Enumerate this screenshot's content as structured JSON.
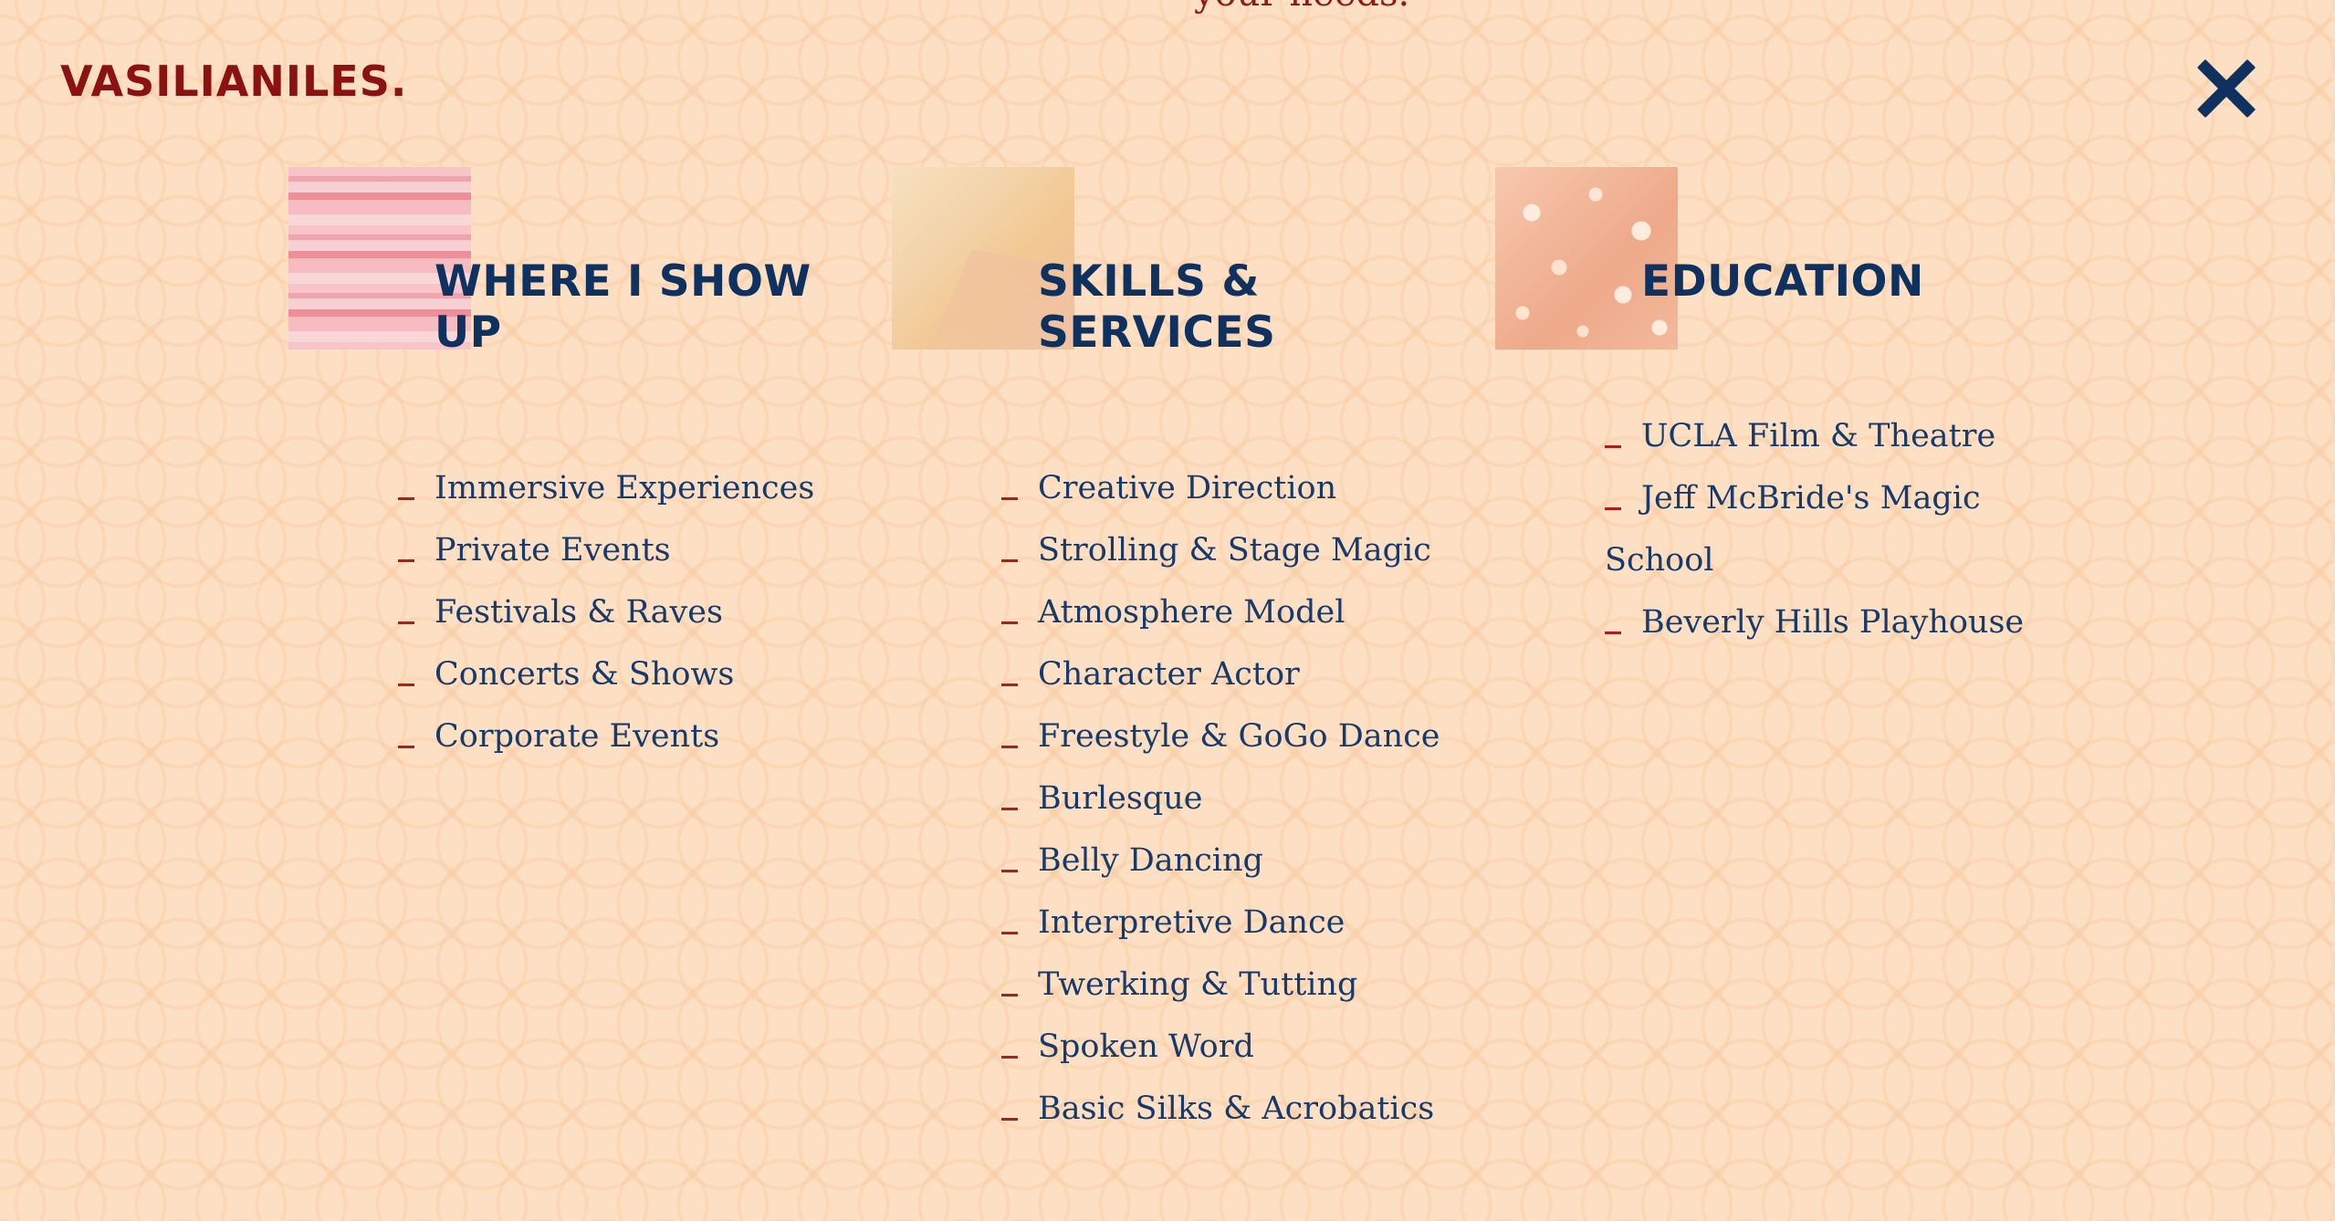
{
  "header": {
    "top_text": "your needs.",
    "logo": "VASILIANILES.",
    "close_icon": "close-icon"
  },
  "columns": [
    {
      "title": "WHERE I SHOW UP",
      "image": "pink-stripes-thumbnail",
      "items": [
        "Immersive Experiences",
        "Private Events",
        "Festivals & Raves",
        "Concerts & Shows",
        "Corporate Events"
      ]
    },
    {
      "title": "SKILLS & SERVICES",
      "image": "gold-foil-thumbnail",
      "items": [
        "Creative Direction",
        "Strolling & Stage Magic",
        "Atmosphere Model",
        "Character Actor",
        "Freestyle & GoGo Dance",
        "Burlesque",
        "Belly Dancing",
        "Interpretive Dance",
        "Twerking & Tutting",
        "Spoken Word",
        "Basic Silks & Acrobatics"
      ]
    },
    {
      "title": "EDUCATION",
      "image": "peach-glitter-thumbnail",
      "items": [
        "UCLA Film & Theatre",
        "Jeff McBride's Magic",
        "School",
        "Beverly Hills Playhouse"
      ]
    }
  ],
  "colors": {
    "background": "#fde0c3",
    "logo": "#8c1212",
    "heading": "#0e3160",
    "text": "#153a6b",
    "bullet": "#b01d1d"
  }
}
